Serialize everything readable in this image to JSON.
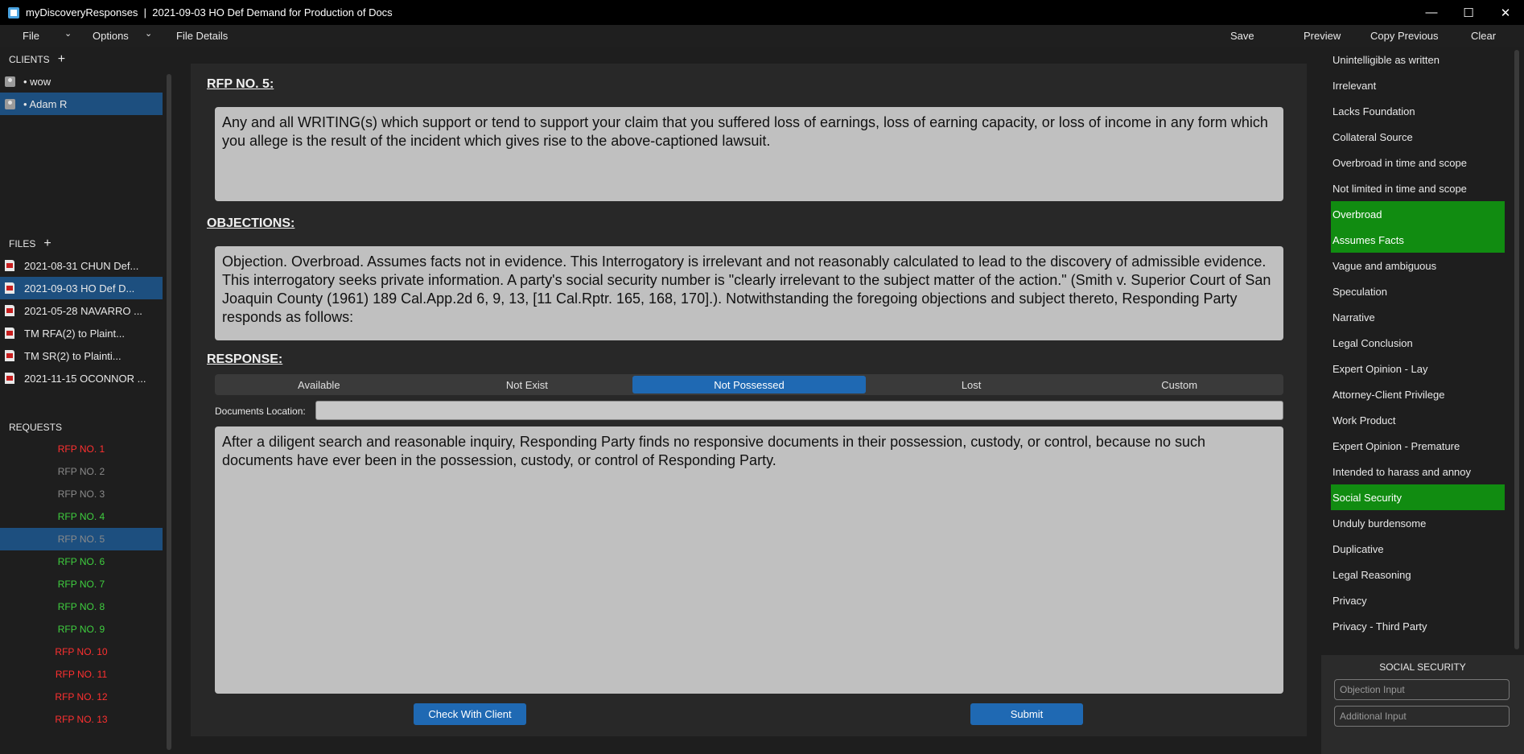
{
  "window": {
    "title": "myDiscoveryResponses  |  2021-09-03 HO Def Demand for Production of Docs",
    "minimize": "—",
    "maximize": "☐",
    "close": "✕"
  },
  "menubar": {
    "file": "File",
    "options": "Options",
    "file_details": "File Details",
    "save": "Save",
    "preview": "Preview",
    "copy_previous": "Copy Previous",
    "clear": "Clear"
  },
  "clients": {
    "header": "CLIENTS",
    "items": [
      {
        "label": "• wow",
        "selected": false
      },
      {
        "label": "• Adam R",
        "selected": true
      }
    ]
  },
  "files": {
    "header": "FILES",
    "items": [
      {
        "label": "2021-08-31 CHUN Def...",
        "selected": false
      },
      {
        "label": "2021-09-03 HO Def D...",
        "selected": true
      },
      {
        "label": "2021-05-28 NAVARRO ...",
        "selected": false
      },
      {
        "label": "TM RFA(2) to Plaint...",
        "selected": false
      },
      {
        "label": "TM SR(2) to Plainti...",
        "selected": false
      },
      {
        "label": "2021-11-15 OCONNOR ...",
        "selected": false
      }
    ]
  },
  "requests": {
    "header": "REQUESTS",
    "items": [
      {
        "label": "RFP NO. 1",
        "status": "red"
      },
      {
        "label": "RFP NO. 2",
        "status": "gray"
      },
      {
        "label": "RFP NO. 3",
        "status": "gray"
      },
      {
        "label": "RFP NO. 4",
        "status": "green"
      },
      {
        "label": "RFP NO. 5",
        "status": "gray",
        "selected": true
      },
      {
        "label": "RFP NO. 6",
        "status": "green"
      },
      {
        "label": "RFP NO. 7",
        "status": "green"
      },
      {
        "label": "RFP NO. 8",
        "status": "green"
      },
      {
        "label": "RFP NO. 9",
        "status": "green"
      },
      {
        "label": "RFP NO. 10",
        "status": "red"
      },
      {
        "label": "RFP NO. 11",
        "status": "red"
      },
      {
        "label": "RFP NO. 12",
        "status": "red"
      },
      {
        "label": "RFP NO. 13",
        "status": "red"
      }
    ]
  },
  "main": {
    "request_title": "RFP NO. 5:",
    "request_text": "Any and all WRITING(s) which support or tend to support your claim that you suffered loss of earnings, loss of earning capacity, or loss of income in any form which you allege is the result of the incident which gives rise to the above-captioned lawsuit.",
    "objections_title": "OBJECTIONS:",
    "objections_text": "Objection. Overbroad. Assumes facts not in evidence. This Interrogatory is irrelevant and not reasonably calculated to lead to the discovery of admissible evidence. This interrogatory seeks private information. A party's social security number is \"clearly irrelevant to the subject matter of the action.\" (Smith v. Superior Court of San Joaquin County (1961) 189 Cal.App.2d 6, 9, 13, [11 Cal.Rptr. 165, 168, 170].). Notwithstanding the foregoing objections and subject thereto, Responding Party responds as follows:",
    "response_title": "RESPONSE:",
    "response_options": [
      "Available",
      "Not Exist",
      "Not Possessed",
      "Lost",
      "Custom"
    ],
    "selected_option": "Not Possessed",
    "documents_location_label": "Documents Location:",
    "documents_location_value": "",
    "response_text": "After a diligent search and reasonable inquiry, Responding Party finds no responsive documents in their possession, custody, or control, because no such documents have ever been in the possession, custody, or control of Responding Party.",
    "check_with_client": "Check With Client",
    "submit": "Submit"
  },
  "objections_panel": {
    "items": [
      {
        "label": "Unintelligible as written",
        "on": false
      },
      {
        "label": "Irrelevant",
        "on": false
      },
      {
        "label": "Lacks Foundation",
        "on": false
      },
      {
        "label": "Collateral Source",
        "on": false
      },
      {
        "label": "Overbroad in time and scope",
        "on": false
      },
      {
        "label": "Not limited in time and scope",
        "on": false
      },
      {
        "label": "Overbroad",
        "on": true
      },
      {
        "label": "Assumes Facts",
        "on": true
      },
      {
        "label": "Vague and ambiguous",
        "on": false
      },
      {
        "label": "Speculation",
        "on": false
      },
      {
        "label": "Narrative",
        "on": false
      },
      {
        "label": "Legal Conclusion",
        "on": false
      },
      {
        "label": "Expert Opinion - Lay",
        "on": false
      },
      {
        "label": "Attorney-Client Privilege",
        "on": false
      },
      {
        "label": "Work Product",
        "on": false
      },
      {
        "label": "Expert Opinion - Premature",
        "on": false
      },
      {
        "label": "Intended to harass and annoy",
        "on": false
      },
      {
        "label": "Social Security",
        "on": true
      },
      {
        "label": "Unduly burdensome",
        "on": false
      },
      {
        "label": "Duplicative",
        "on": false
      },
      {
        "label": "Legal Reasoning",
        "on": false
      },
      {
        "label": "Privacy",
        "on": false
      },
      {
        "label": "Privacy - Third Party",
        "on": false
      }
    ],
    "detail_title": "SOCIAL SECURITY",
    "objection_input_placeholder": "Objection Input",
    "additional_input_placeholder": "Additional Input"
  },
  "colors": {
    "accent": "#1f69b3",
    "selected_row": "#1d4f7f",
    "active_objection": "#118c11",
    "status_red": "#ff3030",
    "status_green": "#3fcf3f",
    "status_gray": "#8a8a8a"
  }
}
